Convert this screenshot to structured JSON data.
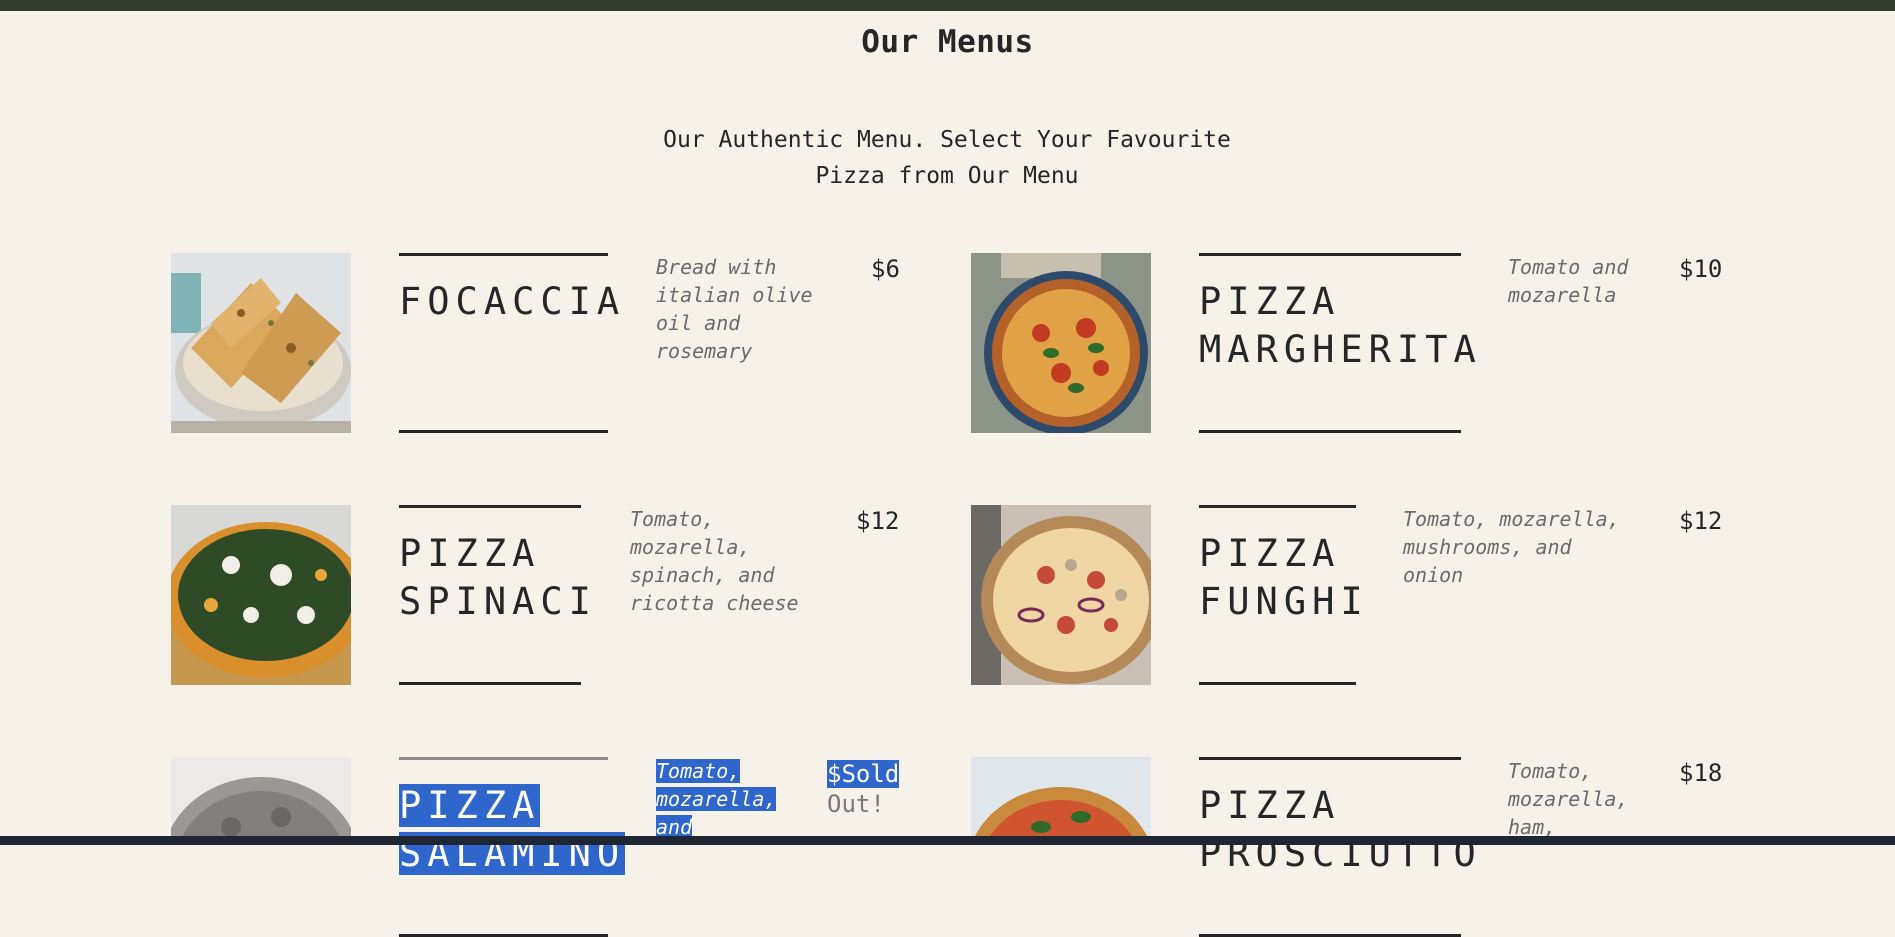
{
  "page": {
    "title": "Our Menus",
    "subtitle_line1": "Our Authentic Menu. Select Your Favourite",
    "subtitle_line2": "Pizza from Our Menu"
  },
  "menu": [
    {
      "name": "FOCACCIA",
      "desc": "Bread with italian olive oil and rosemary",
      "price": "$6",
      "image": "focaccia-photo"
    },
    {
      "name": "PIZZA MARGHERITA",
      "desc": "Tomato and mozarella",
      "price": "$10",
      "image": "margherita-photo"
    },
    {
      "name": "PIZZA SPINACI",
      "desc": "Tomato, mozarella, spinach, and ricotta cheese",
      "price": "$12",
      "image": "spinaci-photo"
    },
    {
      "name": "PIZZA FUNGHI",
      "desc": "Tomato, mozarella, mushrooms, and onion",
      "price": "$12",
      "image": "funghi-photo"
    },
    {
      "name": "PIZZA SALAMINO",
      "desc": "Tomato, mozarella, and",
      "price": "$Sold",
      "price_suffix": "Out!",
      "sold_out": true,
      "image": "salamino-photo"
    },
    {
      "name": "PIZZA PROSCIUTTO",
      "desc": "Tomato, mozarella, ham,",
      "price": "$18",
      "image": "prosciutto-photo"
    }
  ],
  "colors": {
    "background": "#f7f2e9",
    "top_bar": "#333d2f",
    "selection": "#2f66cc",
    "text": "#262626"
  }
}
